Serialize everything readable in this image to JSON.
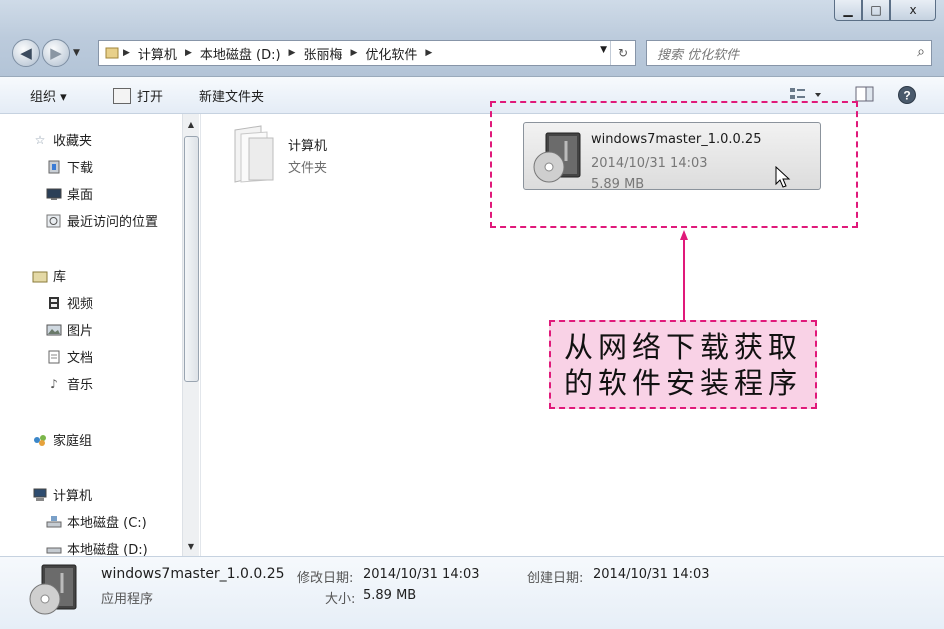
{
  "window": {
    "controls": {
      "minimize": "▁",
      "maximize": "□",
      "close": "x"
    }
  },
  "address_bar": {
    "crumbs": [
      "计算机",
      "本地磁盘 (D:)",
      "张丽梅",
      "优化软件"
    ]
  },
  "search": {
    "placeholder": "搜索 优化软件"
  },
  "toolbar": {
    "organize": "组织 ▾",
    "open": "打开",
    "new_folder": "新建文件夹"
  },
  "sidebar": {
    "favorites": {
      "label": "收藏夹",
      "items": [
        "下载",
        "桌面",
        "最近访问的位置"
      ]
    },
    "libraries": {
      "label": "库",
      "items": [
        "视频",
        "图片",
        "文档",
        "音乐"
      ]
    },
    "homegroup": {
      "label": "家庭组"
    },
    "computer": {
      "label": "计算机",
      "items": [
        "本地磁盘 (C:)",
        "本地磁盘 (D:)"
      ]
    }
  },
  "files": [
    {
      "name": "计算机",
      "type": "文件夹"
    },
    {
      "name": "windows7master_1.0.0.25",
      "date": "2014/10/31 14:03",
      "size": "5.89 MB"
    }
  ],
  "callout": {
    "line1": "从网络下载获取",
    "line2": "的软件安装程序"
  },
  "details": {
    "name": "windows7master_1.0.0.25",
    "type": "应用程序",
    "modified_label": "修改日期:",
    "modified": "2014/10/31 14:03",
    "size_label": "大小:",
    "size": "5.89 MB",
    "created_label": "创建日期:",
    "created": "2014/10/31 14:03"
  },
  "colors": {
    "accent_dash": "#e0197a",
    "callout_bg": "#f9d2e6"
  }
}
